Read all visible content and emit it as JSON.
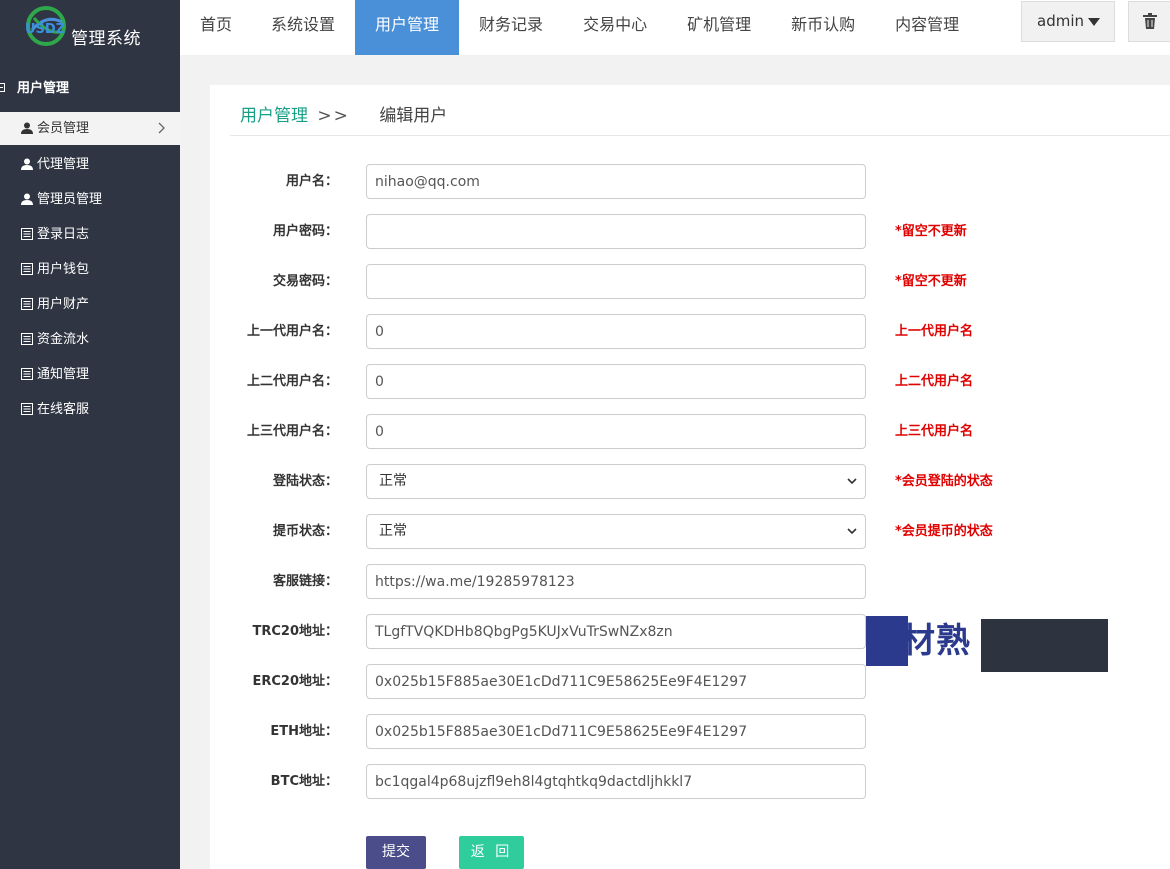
{
  "app": {
    "logo_text": "USDZ",
    "title": "管理系统"
  },
  "topnav": {
    "items": [
      {
        "label": "首页",
        "active": false
      },
      {
        "label": "系统设置",
        "active": false
      },
      {
        "label": "用户管理",
        "active": true
      },
      {
        "label": "财务记录",
        "active": false
      },
      {
        "label": "交易中心",
        "active": false
      },
      {
        "label": "矿机管理",
        "active": false
      },
      {
        "label": "新币认购",
        "active": false
      },
      {
        "label": "内容管理",
        "active": false
      }
    ],
    "user": "admin",
    "trash_icon": "trash-icon"
  },
  "sidebar": {
    "section": "用户管理",
    "items": [
      {
        "label": "会员管理",
        "icon": "user-icon",
        "active": true
      },
      {
        "label": "代理管理",
        "icon": "user-icon",
        "active": false
      },
      {
        "label": "管理员管理",
        "icon": "user-icon",
        "active": false
      },
      {
        "label": "登录日志",
        "icon": "list-icon",
        "active": false
      },
      {
        "label": "用户钱包",
        "icon": "list-icon",
        "active": false
      },
      {
        "label": "用户财产",
        "icon": "list-icon",
        "active": false
      },
      {
        "label": "资金流水",
        "icon": "list-icon",
        "active": false
      },
      {
        "label": "通知管理",
        "icon": "list-icon",
        "active": false
      },
      {
        "label": "在线客服",
        "icon": "list-icon",
        "active": false
      }
    ]
  },
  "breadcrumb": {
    "parent": "用户管理",
    "separator": ">>",
    "current": "编辑用户"
  },
  "form": {
    "fields": [
      {
        "label": "用户名：",
        "type": "text",
        "value": "nihao@qq.com",
        "hint": ""
      },
      {
        "label": "用户密码：",
        "type": "password",
        "value": "",
        "hint": "*留空不更新"
      },
      {
        "label": "交易密码：",
        "type": "password",
        "value": "",
        "hint": "*留空不更新"
      },
      {
        "label": "上一代用户名：",
        "type": "text",
        "value": "0",
        "hint": "上一代用户名"
      },
      {
        "label": "上二代用户名：",
        "type": "text",
        "value": "0",
        "hint": "上二代用户名"
      },
      {
        "label": "上三代用户名：",
        "type": "text",
        "value": "0",
        "hint": "上三代用户名"
      },
      {
        "label": "登陆状态：",
        "type": "select",
        "value": "正常",
        "hint": "*会员登陆的状态"
      },
      {
        "label": "提币状态：",
        "type": "select",
        "value": "正常",
        "hint": "*会员提币的状态"
      },
      {
        "label": "客服链接：",
        "type": "text",
        "value": "https://wa.me/19285978123",
        "hint": ""
      },
      {
        "label": "TRC20地址：",
        "type": "text",
        "value": "TLgfTVQKDHb8QbgPg5KUJxVuTrSwNZx8zn",
        "hint": ""
      },
      {
        "label": "ERC20地址：",
        "type": "text",
        "value": "0x025b15F885ae30E1cDd711C9E58625Ee9F4E1297",
        "hint": ""
      },
      {
        "label": "ETH地址：",
        "type": "text",
        "value": "0x025b15F885ae30E1cDd711C9E58625Ee9F4E1297",
        "hint": ""
      },
      {
        "label": "BTC地址：",
        "type": "text",
        "value": "bc1qgal4p68ujzfl9eh8l4gtqhtkq9dactdljhkkl7",
        "hint": ""
      }
    ],
    "submit_label": "提交",
    "back_label": "返 回"
  },
  "watermark": "素材熟",
  "colors": {
    "sidebar_bg": "#2f3542",
    "nav_active": "#4a90d9",
    "breadcrumb_link": "#17a085",
    "hint_red": "#e00000",
    "submit_bg": "#4a4d8a",
    "back_bg": "#2fcc9c"
  }
}
